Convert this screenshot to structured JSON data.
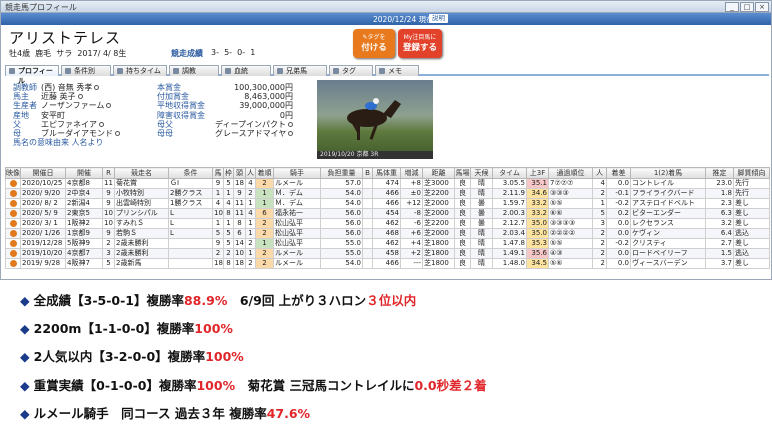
{
  "window": {
    "title": "競走馬プロフィール",
    "date": "2020/12/24 現在",
    "help": "説明"
  },
  "horse": {
    "name": "アリストテレス",
    "info": "牡4歳  鹿毛  サラ  2017/ 4/ 8生",
    "career_label": "競走成績",
    "career": "3-  5-  0-  1"
  },
  "orange_buttons": [
    {
      "sub": "✎タグを",
      "label": "付ける",
      "color": "#e8791c"
    },
    {
      "sub": "My注目馬に",
      "label": "登録する",
      "color": "#e2412a"
    }
  ],
  "tabs": [
    "プロフィール",
    "条件別",
    "持ちタイム",
    "調教",
    "血統",
    "兄弟馬",
    "タグ",
    "メモ"
  ],
  "profile": [
    {
      "label": "調教師",
      "value": "(西) 音無 秀孝"
    },
    {
      "label": "馬主",
      "value": "近藤 英子"
    },
    {
      "label": "生産者",
      "value": "ノーザンファーム"
    },
    {
      "label": "産地",
      "value": "安平町"
    },
    {
      "label": "父",
      "value": "エピファネイア"
    },
    {
      "label": "母",
      "value": "ブルーダイアモンド"
    },
    {
      "label": "",
      "value": "馬名の意味由来 人名より"
    }
  ],
  "prizes": [
    {
      "label": "本賞金",
      "value": "100,300,000円"
    },
    {
      "label": "付加賞金",
      "value": "8,463,000円"
    },
    {
      "label": "平地収得賞金",
      "value": "39,000,000円"
    },
    {
      "label": "障害収得賞金",
      "value": "0円"
    },
    {
      "label": "母父",
      "value": "ディープインパクト"
    },
    {
      "label": "母母",
      "value": "グレースアドマイヤ"
    }
  ],
  "photo_caption": "2019/10/20 京都 3R",
  "table": {
    "headers": [
      "映像",
      "開催日",
      "開催",
      "R",
      "競走名",
      "条件",
      "馬",
      "枠",
      "頭",
      "人",
      "着順",
      "騎手",
      "負担重量",
      "B",
      "馬体重",
      "増減",
      "距離",
      "馬場",
      "天候",
      "タイム",
      "上3F",
      "通過順位",
      "人",
      "着差",
      "1(2)着馬",
      "推定",
      "脚質傾向"
    ],
    "rows": [
      [
        "",
        "2020/10/25",
        "4京都8",
        "11",
        "菊花賞",
        "ＧⅠ",
        "9",
        "5",
        "18",
        "4",
        "2",
        "ルメール",
        "57.0",
        "",
        "474",
        "+8",
        "芝3000",
        "良",
        "晴",
        "3.05.5",
        "35.1",
        "7⑦⑦⑦",
        "4",
        "0.0",
        "コントレイル",
        "23.0",
        "先行"
      ],
      [
        "",
        "2020/ 9/20",
        "2中京4",
        "9",
        "小牧特別",
        "2勝クラス",
        "1",
        "1",
        "9",
        "2",
        "1",
        "Ｍ．デム",
        "54.0",
        "",
        "466",
        "±0",
        "芝2200",
        "良",
        "晴",
        "2.11.9",
        "34.6",
        "③③③",
        "2",
        "-0.1",
        "フライライクバード",
        "1.8",
        "先行"
      ],
      [
        "",
        "2020/ 8/ 2",
        "2新潟4",
        "9",
        "出雲崎特別",
        "1勝クラス",
        "4",
        "4",
        "11",
        "1",
        "1",
        "Ｍ．デム",
        "54.0",
        "",
        "466",
        "+12",
        "芝2000",
        "良",
        "曇",
        "1.59.7",
        "33.2",
        "⑤⑤",
        "1",
        "-0.2",
        "アステロイドベルト",
        "2.3",
        "差し"
      ],
      [
        "",
        "2020/ 5/ 9",
        "2東京5",
        "10",
        "プリンシパル",
        "L",
        "10",
        "8",
        "11",
        "4",
        "6",
        "福永祐一",
        "56.0",
        "",
        "454",
        "-8",
        "芝2000",
        "良",
        "曇",
        "2.00.3",
        "33.2",
        "⑥⑥",
        "5",
        "0.2",
        "ビターエンダー",
        "6.3",
        "差し"
      ],
      [
        "",
        "2020/ 3/ 1",
        "1阪神2",
        "10",
        "すみれＳ",
        "L",
        "1",
        "1",
        "8",
        "1",
        "2",
        "松山弘平",
        "56.0",
        "",
        "462",
        "-6",
        "芝2200",
        "良",
        "曇",
        "2.12.7",
        "35.0",
        "③③③③",
        "3",
        "0.0",
        "レクセランス",
        "3.2",
        "差し"
      ],
      [
        "",
        "2020/ 1/26",
        "1京都9",
        "9",
        "若駒Ｓ",
        "L",
        "5",
        "5",
        "6",
        "1",
        "2",
        "松山弘平",
        "56.0",
        "",
        "468",
        "+6",
        "芝2000",
        "良",
        "晴",
        "2.03.4",
        "35.0",
        "②②②②",
        "2",
        "0.0",
        "ケヴィン",
        "6.4",
        "逃込"
      ],
      [
        "",
        "2019/12/28",
        "5阪神9",
        "2",
        "2歳未勝利",
        "",
        "9",
        "5",
        "14",
        "2",
        "1",
        "松山弘平",
        "55.0",
        "",
        "462",
        "+4",
        "芝1800",
        "良",
        "晴",
        "1.47.8",
        "35.3",
        "⑤⑤",
        "2",
        "-0.2",
        "クリスティ",
        "2.7",
        "差し"
      ],
      [
        "",
        "2019/10/20",
        "4京都7",
        "3",
        "2歳未勝利",
        "",
        "2",
        "2",
        "10",
        "1",
        "2",
        "ルメール",
        "55.0",
        "",
        "458",
        "+2",
        "芝1800",
        "良",
        "晴",
        "1.49.1",
        "35.6",
        "④③",
        "2",
        "0.0",
        "ロードベイリーフ",
        "1.5",
        "逃込"
      ],
      [
        "",
        "2019/ 9/28",
        "4阪神7",
        "5",
        "2歳新馬",
        "",
        "18",
        "8",
        "18",
        "2",
        "2",
        "ルメール",
        "54.0",
        "",
        "466",
        "---",
        "芝1800",
        "良",
        "晴",
        "1.48.0",
        "34.5",
        "⑤⑥",
        "2",
        "0.0",
        "ヴィースバーデン",
        "3.7",
        "差し"
      ]
    ]
  },
  "stats": [
    {
      "parts": [
        {
          "t": "全成績【3-5-0-1】複勝率",
          "c": "k"
        },
        {
          "t": "88.9%",
          "c": "r"
        },
        {
          "t": "　6/9回 上がり３ハロン",
          "c": "k"
        },
        {
          "t": "３位以内",
          "c": "r"
        }
      ]
    },
    {
      "parts": [
        {
          "t": "2200m【1-1-0-0】複勝率",
          "c": "k"
        },
        {
          "t": "100%",
          "c": "r"
        }
      ]
    },
    {
      "parts": [
        {
          "t": "2人気以内【3-2-0-0】複勝率",
          "c": "k"
        },
        {
          "t": "100%",
          "c": "r"
        }
      ]
    },
    {
      "parts": [
        {
          "t": "重賞実績【0-1-0-0】複勝率",
          "c": "k"
        },
        {
          "t": "100%",
          "c": "r"
        },
        {
          "t": "　菊花賞 三冠馬コントレイルに",
          "c": "k"
        },
        {
          "t": "0.0秒差２着",
          "c": "r"
        }
      ]
    },
    {
      "parts": [
        {
          "t": "ルメール騎手　同コース 過去３年 複勝率",
          "c": "k"
        },
        {
          "t": "47.6%",
          "c": "r"
        }
      ]
    }
  ]
}
